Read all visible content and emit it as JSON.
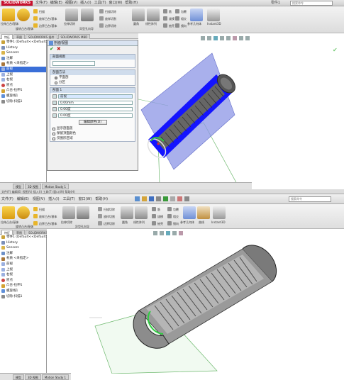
{
  "top": {
    "app_logo": "SOLIDWORKS",
    "menus": [
      "文件(F)",
      "编辑(E)",
      "视图(V)",
      "插入(I)",
      "工具(T)",
      "窗口(W)",
      "帮助(H)"
    ],
    "window_title": "零件1",
    "search_placeholder": "搜索命令",
    "ribbon": {
      "extrude_boss": "拉伸凸台/基体",
      "revolve_boss": "旋转凸台/基体",
      "sweep": "扫描",
      "loft": "放样凸台/基体",
      "boundary": "边界凸台/基体",
      "extrude_cut": "拉伸切除",
      "hole_wizard": "异型孔向导",
      "revolve_cut": "旋转切除",
      "sweep_cut": "扫描切除",
      "loft_cut": "放样切割",
      "boundary_cut": "边界切除",
      "fillet": "圆角",
      "pattern": "线性阵列",
      "rib": "筋",
      "draft": "拔模",
      "shell": "抽壳",
      "wrap": "包覆",
      "intersect": "相交",
      "mirror": "镜向",
      "ref_geometry": "参考几何体",
      "curves": "曲线",
      "instant3d": "Instant3D"
    },
    "tabs": [
      "特征",
      "草图",
      "SOLIDWORKS 插件",
      "SOLIDWORKS MBD"
    ],
    "tree": [
      "零件1 (Default<<Default>_显示...)",
      "History",
      "Sensors",
      "注解",
      "材质 <未指定>",
      "前视",
      "上视",
      "右视",
      "原点",
      "凸台-拉伸1",
      "螺旋线1",
      "切除-扫描1"
    ],
    "pm": {
      "title": "剖面视图",
      "sec_options": "剖面视图",
      "sec_method": "剖面方法",
      "method_options": [
        "平面剖",
        "分区"
      ],
      "sec_section1": "剖面 1",
      "plane_value": "前视",
      "distance": "0.00mm",
      "angle_x": "0.00度",
      "angle_y": "0.00度",
      "edit_color": "编辑颜色(D)",
      "checkboxes": [
        "显示剖面盖",
        "保留顶面颜色",
        "仅图形区域"
      ]
    },
    "status_tabs": [
      "模型",
      "3D 视图",
      "Motion Study 1"
    ]
  },
  "bottom": {
    "title_text": "文件(F) 编辑(E) 视图(V) 插入(I) 工具(T) 窗口(W) 帮助(H)",
    "menus": [
      "文件(F)",
      "编辑(E)",
      "视图(V)",
      "插入(I)",
      "工具(T)",
      "窗口(W)",
      "帮助(H)"
    ],
    "search_placeholder": "搜索命令",
    "ribbon": {
      "extrude_boss": "拉伸凸台/基体",
      "revolve_boss": "旋转凸台/基体",
      "sweep": "扫描",
      "loft": "放样凸台/基体",
      "boundary": "边界凸台/基体",
      "extrude_cut": "拉伸切除",
      "hole_wizard": "异型孔向导",
      "revolve_cut": "旋转切除",
      "sweep_cut": "扫描切除",
      "loft_cut": "放样切割",
      "boundary_cut": "边界切除",
      "fillet": "圆角",
      "pattern": "线性阵列",
      "rib": "筋",
      "draft": "拔模",
      "shell": "抽壳",
      "wrap": "包覆",
      "intersect": "相交",
      "mirror": "镜向",
      "ref_geometry": "参考几何体",
      "curves": "曲线",
      "instant3d": "Instant3D"
    },
    "tabs": [
      "特征",
      "草图",
      "SOLIDWORKS 插件"
    ],
    "tree": [
      "零件1 (Default<<Default>_显示...)",
      "History",
      "Sensors",
      "注解",
      "材质 <未指定>",
      "前视",
      "上视",
      "右视",
      "原点",
      "凸台-拉伸1",
      "螺旋线1",
      "切除-扫描1"
    ],
    "status_tabs": [
      "模型",
      "3D 视图",
      "Motion Study 1"
    ]
  },
  "colors": {
    "accent_blue": "#3a6fd8",
    "section_plane": "#8c96e6",
    "cut_face": "#1414ff",
    "thread": "#5a5a5a",
    "brand_red": "#c8102e"
  }
}
